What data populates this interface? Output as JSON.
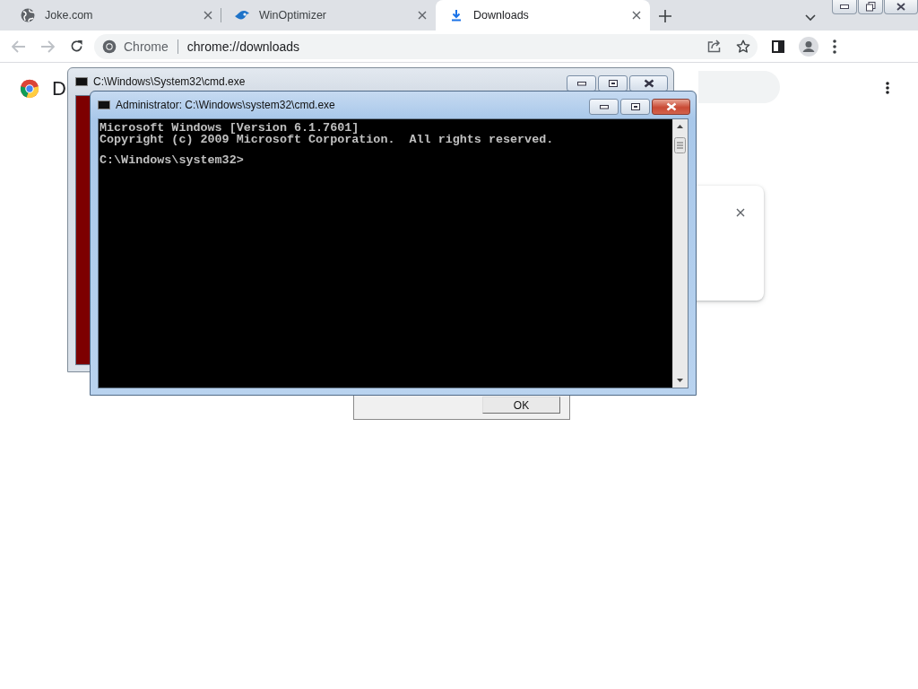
{
  "tabs": [
    {
      "title": "Joke.com",
      "selected": false
    },
    {
      "title": "WinOptimizer",
      "selected": false
    },
    {
      "title": "Downloads",
      "selected": true
    }
  ],
  "address_bar": {
    "site_label": "Chrome",
    "url": "chrome://downloads"
  },
  "page": {
    "title": "D"
  },
  "dialog": {
    "button": "OK"
  },
  "windows": [
    {
      "kind": "console",
      "title": "C:\\Windows\\System32\\cmd.exe",
      "active": false
    },
    {
      "kind": "console",
      "title": "Administrator: C:\\Windows\\system32\\cmd.exe",
      "active": true,
      "lines": [
        {
          "kind": "output",
          "text": "Microsoft Windows [Version 6.1.7601]"
        },
        {
          "kind": "output",
          "text": "Copyright (c) 2009 Microsoft Corporation.  All rights reserved."
        },
        {
          "kind": "prompt",
          "text": "C:\\Windows\\system32>"
        }
      ]
    }
  ]
}
